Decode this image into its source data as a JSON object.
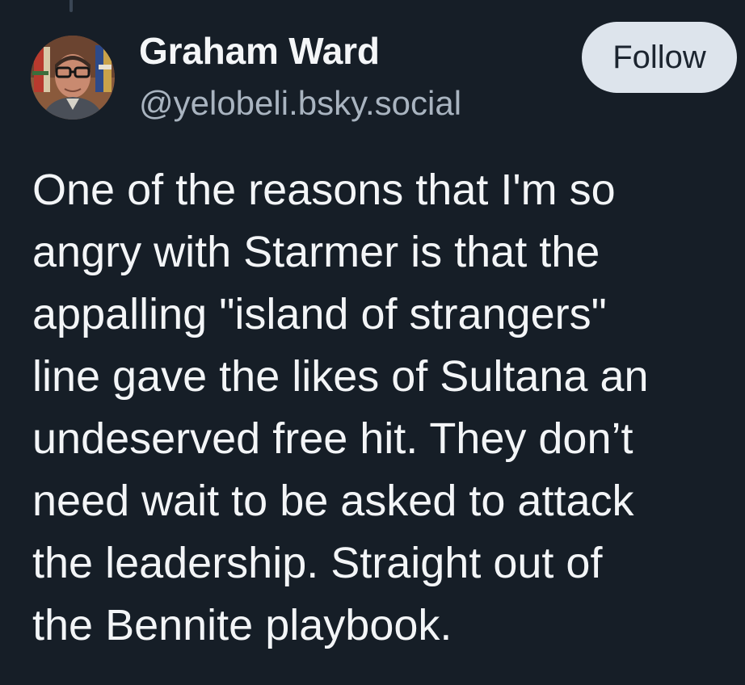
{
  "author": {
    "display_name": "Graham Ward",
    "handle": "@yelobeli.bsky.social",
    "avatar_icon": "profile-photo"
  },
  "follow_button": {
    "label": "Follow"
  },
  "post": {
    "lines": [
      "One of the reasons that I'm so",
      "angry with Starmer is that the",
      "appalling \"island of strangers\"",
      "line gave the likes of Sultana an",
      "undeserved free hit. They don’t",
      "need wait to be asked to attack",
      "the leadership. Straight out of",
      "the Bennite playbook."
    ]
  },
  "colors": {
    "background": "#161e27",
    "text": "#f3f5f7",
    "handle": "#a9b4c0",
    "button_bg": "#dde4ec",
    "button_text": "#1c2530"
  }
}
